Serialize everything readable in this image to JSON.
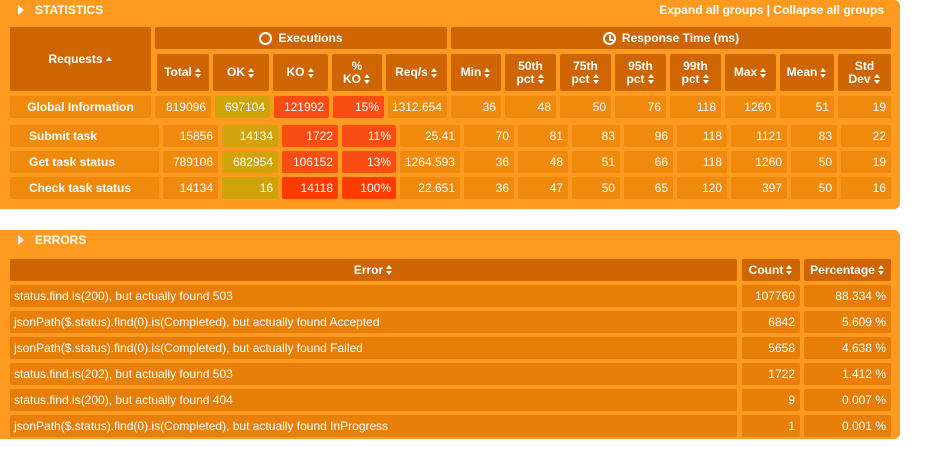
{
  "statistics": {
    "title": "STATISTICS",
    "expand_all": "Expand all groups",
    "separator": "|",
    "collapse_all": "Collapse all groups",
    "headers": {
      "requests": "Requests",
      "executions": "Executions",
      "response_time": "Response Time (ms)",
      "total": "Total",
      "ok": "OK",
      "ko": "KO",
      "pct_ko_line1": "%",
      "pct_ko_line2": "KO",
      "reqs": "Req/s",
      "min": "Min",
      "p50_line1": "50th",
      "p50_line2": "pct",
      "p75_line1": "75th",
      "p75_line2": "pct",
      "p95_line1": "95th",
      "p95_line2": "pct",
      "p99_line1": "99th",
      "p99_line2": "pct",
      "max": "Max",
      "mean": "Mean",
      "std_line1": "Std",
      "std_line2": "Dev"
    },
    "rows": [
      {
        "name": "Global Information",
        "total": "819096",
        "ok": "697104",
        "ko": "121992",
        "pct_ko": "15%",
        "reqs": "1312.654",
        "min": "36",
        "p50": "48",
        "p75": "50",
        "p95": "76",
        "p99": "118",
        "max": "1260",
        "mean": "51",
        "std": "19"
      },
      {
        "name": "Submit task",
        "total": "15856",
        "ok": "14134",
        "ko": "1722",
        "pct_ko": "11%",
        "reqs": "25.41",
        "min": "70",
        "p50": "81",
        "p75": "83",
        "p95": "96",
        "p99": "118",
        "max": "1121",
        "mean": "83",
        "std": "22"
      },
      {
        "name": "Get task status",
        "total": "789106",
        "ok": "682954",
        "ko": "106152",
        "pct_ko": "13%",
        "reqs": "1264.593",
        "min": "36",
        "p50": "48",
        "p75": "51",
        "p95": "66",
        "p99": "118",
        "max": "1260",
        "mean": "50",
        "std": "19"
      },
      {
        "name": "Check task status",
        "total": "14134",
        "ok": "16",
        "ko": "14118",
        "pct_ko": "100%",
        "reqs": "22.651",
        "min": "36",
        "p50": "47",
        "p75": "50",
        "p95": "65",
        "p99": "120",
        "max": "397",
        "mean": "50",
        "std": "16"
      }
    ]
  },
  "errors": {
    "title": "ERRORS",
    "headers": {
      "error": "Error",
      "count": "Count",
      "percentage": "Percentage"
    },
    "rows": [
      {
        "message": "status.find.is(200), but actually found 503",
        "count": "107760",
        "percentage": "88.334 %"
      },
      {
        "message": "jsonPath($.status).find(0).is(Completed), but actually found Accepted",
        "count": "6842",
        "percentage": "5.609 %"
      },
      {
        "message": "jsonPath($.status).find(0).is(Completed), but actually found Failed",
        "count": "5658",
        "percentage": "4.638 %"
      },
      {
        "message": "status.find.is(202), but actually found 503",
        "count": "1722",
        "percentage": "1.412 %"
      },
      {
        "message": "status.find.is(200), but actually found 404",
        "count": "9",
        "percentage": "0.007 %"
      },
      {
        "message": "jsonPath($.status).find(0).is(Completed), but actually found InProgress",
        "count": "1",
        "percentage": "0.001 %"
      }
    ]
  },
  "colors": {
    "panel_bg": "#fd9a1f",
    "header_bg": "#cf6500",
    "cell_bg": "#f08a0d",
    "ok_good": "#8bb326",
    "ok_low": "#d0a30b",
    "ko_bg": "#fa4d13"
  },
  "icons": {
    "collapse": "triangle-right-icon",
    "executions": "refresh-icon",
    "response_time": "clock-icon",
    "sort": "sort-arrows-icon"
  }
}
